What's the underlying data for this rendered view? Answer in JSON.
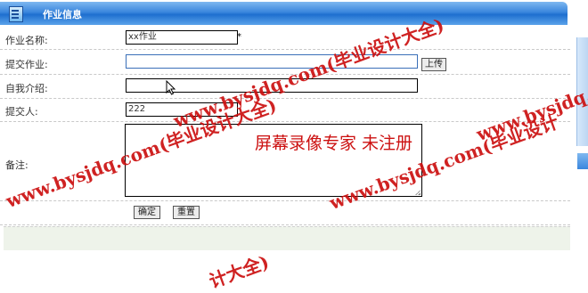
{
  "header": {
    "title": "作业信息"
  },
  "form": {
    "name": {
      "label": "作业名称:",
      "value": "xx作业",
      "required_mark": "*"
    },
    "submit_file": {
      "label": "提交作业:",
      "value": "",
      "upload_label": "上传"
    },
    "intro": {
      "label": "自我介绍:",
      "value": ""
    },
    "submitter": {
      "label": "提交人:",
      "value": "222"
    },
    "remark": {
      "label": "备注:",
      "value": ""
    },
    "confirm_label": "确定",
    "reset_label": "重置"
  },
  "watermarks": {
    "site": "www.bysjdq.com(毕业设计大全)",
    "site_partial_1": "www.bysjdq.com(毕业设计大全)",
    "site_partial_2": "www.bysjdq.com(毕业设计",
    "recorder": "屏幕录像专家  未注册",
    "fragment": "计大全)"
  },
  "colors": {
    "watermark": "#cc1010",
    "header": "#3a86dd"
  }
}
